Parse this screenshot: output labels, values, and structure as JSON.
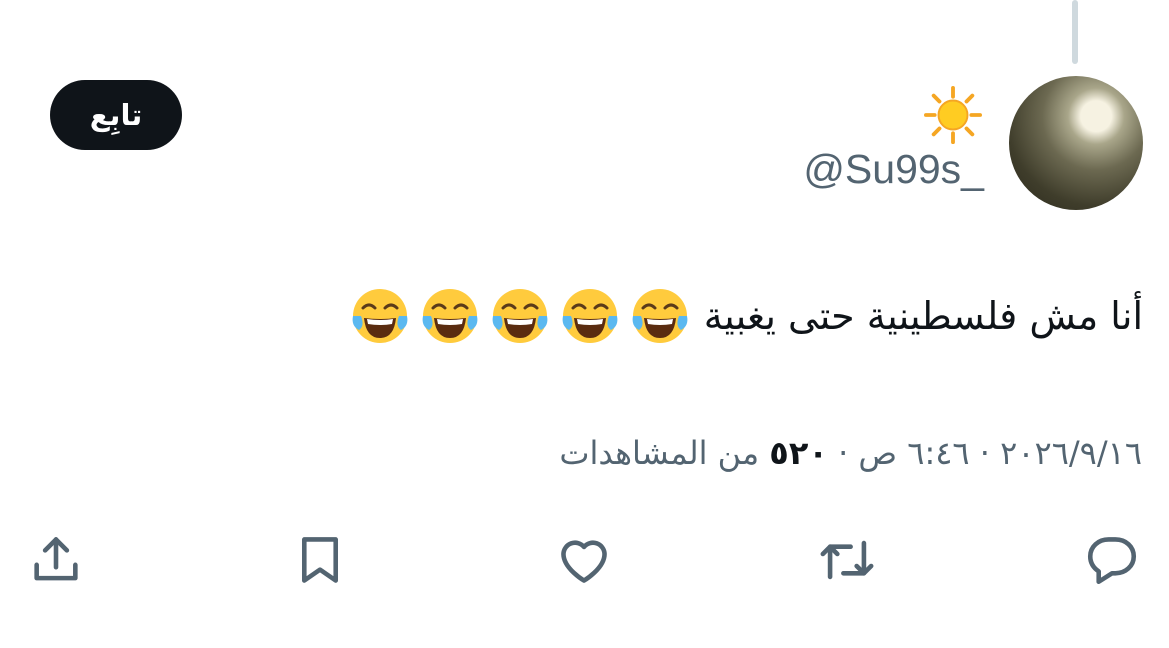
{
  "author": {
    "display_name_emoji": "sun-emoji",
    "handle": "@Su99s_"
  },
  "follow_button": {
    "label": "تابِع"
  },
  "tweet": {
    "text": "أنا مش فلسطينية حتى يغبية",
    "emoji": "face-with-tears-of-joy",
    "emoji_count": 5
  },
  "meta": {
    "date": "٢٠٢٦/٩/١٦",
    "separator": "·",
    "time": "٦:٤٦ ص",
    "views_count": "٥٢٠",
    "views_label": "من المشاهدات"
  },
  "actions": [
    {
      "name": "reply",
      "icon": "reply-icon"
    },
    {
      "name": "retweet",
      "icon": "retweet-icon"
    },
    {
      "name": "like",
      "icon": "heart-icon"
    },
    {
      "name": "bookmark",
      "icon": "bookmark-icon"
    },
    {
      "name": "share",
      "icon": "share-icon"
    }
  ],
  "colors": {
    "text": "#0f1419",
    "secondary": "#536471",
    "thread_line": "#cfd9de",
    "follow_bg": "#0f1419",
    "follow_text": "#ffffff"
  }
}
